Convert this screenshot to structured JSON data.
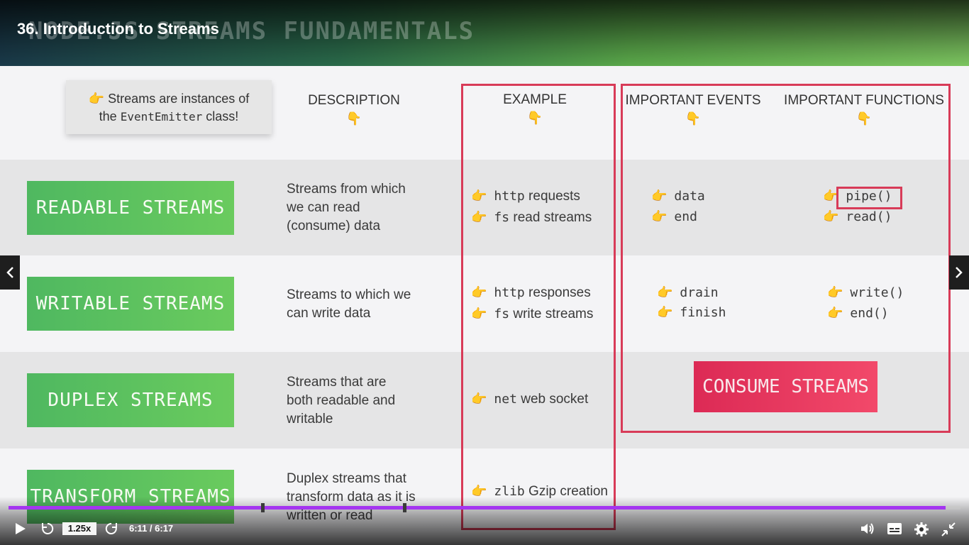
{
  "header": {
    "video_title": "36. Introduction to Streams",
    "slide_title": "NODE.JS STREAMS FUNDAMENTALS"
  },
  "note": {
    "line1": "Streams are instances of",
    "line2_pre": "the ",
    "line2_code": "EventEmitter",
    "line2_post": " class!"
  },
  "columns": {
    "description": "DESCRIPTION",
    "example": "EXAMPLE",
    "events": "IMPORTANT EVENTS",
    "functions": "IMPORTANT FUNCTIONS",
    "pointer_down": "👇"
  },
  "hand_icon": "👉",
  "rows": [
    {
      "label": "READABLE STREAMS",
      "desc": "Streams from which we can read (consume) data",
      "examples": [
        {
          "code": "http",
          "text": " requests"
        },
        {
          "code": "fs",
          "text": " read streams"
        }
      ],
      "events": [
        "data",
        "end"
      ],
      "functions": [
        "pipe()",
        "read()"
      ]
    },
    {
      "label": "WRITABLE  STREAMS",
      "desc": "Streams to which we can write data",
      "examples": [
        {
          "code": "http",
          "text": " responses"
        },
        {
          "code": "fs",
          "text": " write streams"
        }
      ],
      "events": [
        "drain",
        "finish"
      ],
      "functions": [
        "write()",
        "end()"
      ]
    },
    {
      "label": "DUPLEX  STREAMS",
      "desc": "Streams that are both readable and writable",
      "examples": [
        {
          "code": "net",
          "text": " web socket"
        }
      ]
    },
    {
      "label": "TRANSFORM  STREAMS",
      "desc": "Duplex streams that transform data as it is written or read",
      "examples": [
        {
          "code": "zlib",
          "text": " Gzip creation"
        }
      ]
    }
  ],
  "consume_label": "CONSUME STREAMS",
  "player": {
    "speed": "1.25x",
    "time": "6:11 / 6:17",
    "progress": 0.984,
    "play_icon": "play-icon",
    "accent": "#a435f0"
  },
  "colors": {
    "green": "#5cc05e",
    "red": "#d83b58",
    "hand": "#f5b423"
  }
}
